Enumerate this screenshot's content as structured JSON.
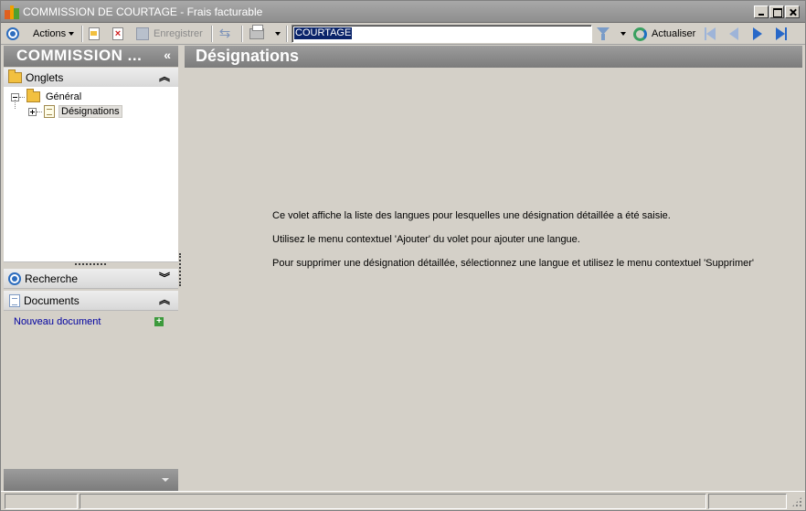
{
  "window": {
    "title": "COMMISSION DE COURTAGE",
    "subtitle": "Frais facturable",
    "title_separator": "-"
  },
  "toolbar": {
    "actions_label": "Actions",
    "save_label": "Enregistrer",
    "search_value": "COURTAGE",
    "refresh_label": "Actualiser"
  },
  "left_panel": {
    "header_title": "COMMISSION ...",
    "collapse_glyph": "«",
    "tabs_section": "Onglets",
    "tree": [
      {
        "label": "Général",
        "expanded": true
      },
      {
        "label": "Désignations",
        "expanded": false,
        "selected": true
      }
    ],
    "search_section": "Recherche",
    "documents_section": "Documents",
    "new_document_link": "Nouveau document",
    "add_glyph": "+"
  },
  "main": {
    "header_title": "Désignations",
    "info_lines": [
      "Ce volet affiche la liste des langues pour lesquelles une désignation détaillée a été saisie.",
      "Utilisez le menu contextuel 'Ajouter' du volet pour ajouter une langue.",
      "Pour supprimer une désignation détaillée, sélectionnez une langue et utilisez le menu contextuel 'Supprimer'"
    ]
  },
  "colors": {
    "header_gradient": "#8c8c8c",
    "accent_blue": "#2d6dbe",
    "link": "#0000a0",
    "selection": "#0a246a"
  }
}
